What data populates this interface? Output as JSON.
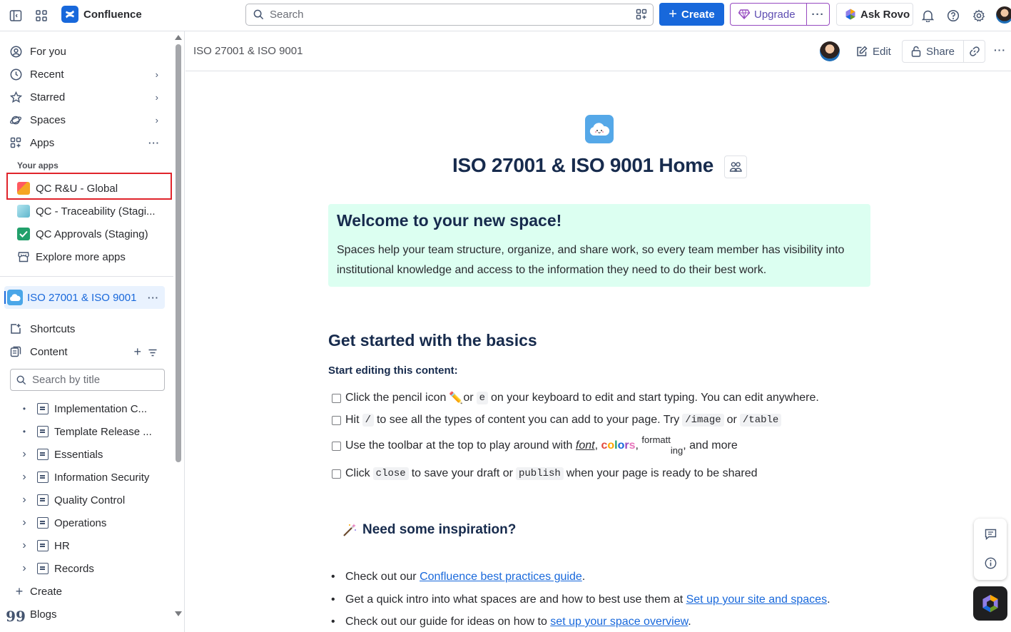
{
  "topbar": {
    "app_name": "Confluence",
    "search_placeholder": "Search",
    "create_label": "Create",
    "upgrade_label": "Upgrade",
    "more_label": "···",
    "ask_rovo_label": "Ask Rovo"
  },
  "sidebar": {
    "nav": [
      {
        "label": "For you",
        "icon": "user-circle-icon"
      },
      {
        "label": "Recent",
        "icon": "clock-icon"
      },
      {
        "label": "Starred",
        "icon": "star-icon"
      },
      {
        "label": "Spaces",
        "icon": "planet-icon"
      },
      {
        "label": "Apps",
        "icon": "apps-grid-icon"
      }
    ],
    "your_apps_label": "Your apps",
    "apps": [
      {
        "label": "QC R&U - Global",
        "color": "#f5a623"
      },
      {
        "label": "QC - Traceability (Stagi...",
        "color": "#7ec8d8"
      },
      {
        "label": "QC Approvals (Staging)",
        "color": "#22a06b"
      },
      {
        "label": "Explore more apps",
        "color": "#44546f"
      }
    ],
    "space_name": "ISO 27001 & ISO 9001",
    "shortcuts_label": "Shortcuts",
    "content_label": "Content",
    "search_placeholder": "Search by title",
    "tree": [
      {
        "label": "Implementation C...",
        "lead": "•"
      },
      {
        "label": "Template Release ...",
        "lead": "•"
      },
      {
        "label": "Essentials",
        "lead": "›"
      },
      {
        "label": "Information Security",
        "lead": "›"
      },
      {
        "label": "Quality Control",
        "lead": "›"
      },
      {
        "label": "Operations",
        "lead": "›"
      },
      {
        "label": "HR",
        "lead": "›"
      },
      {
        "label": "Records",
        "lead": "›"
      }
    ],
    "create_label": "Create",
    "blogs_label": "Blogs"
  },
  "header": {
    "breadcrumb": "ISO 27001 & ISO 9001",
    "edit_label": "Edit",
    "share_label": "Share"
  },
  "page": {
    "title": "ISO 27001 & ISO 9001 Home",
    "panel_title": "Welcome to your new space!",
    "panel_body": "Spaces help your team structure, organize, and share work, so every team member has visibility into institutional knowledge and access to the information they need to do their best work.",
    "basics_heading": "Get started with the basics",
    "start_editing": "Start editing this content:",
    "task1": {
      "a": "Click the pencil icon ",
      "emoji": "✏️",
      "b": " or ",
      "code": "e",
      "c": " on your keyboard to edit and start typing. You can edit anywhere."
    },
    "task2": {
      "a": "Hit ",
      "code1": "/",
      "b": " to see all the types of content you can add to your page. Try ",
      "code2": "/image",
      "c": " or ",
      "code3": "/table"
    },
    "task3": {
      "a": "Use the toolbar at the top to play around with ",
      "font": "font",
      "comma": ", ",
      "colors": "colors",
      "comma2": ", ",
      "sup": "formatt",
      "sub": "ing",
      "b": ", and more"
    },
    "task4": {
      "a": "Click ",
      "code1": "close",
      "b": " to save your draft or ",
      "code2": "publish",
      "c": " when your page is ready to be shared"
    },
    "inspiration_heading": "Need some inspiration?",
    "bullets": [
      {
        "pre": "Check out our ",
        "link": "Confluence best practices guide",
        "post": "."
      },
      {
        "pre": "Get a quick intro into what spaces are and how to best use them at ",
        "link": "Set up your site and spaces",
        "post": "."
      },
      {
        "pre": "Check out our guide for ideas on how to ",
        "link": "set up your space overview",
        "post": "."
      }
    ]
  }
}
